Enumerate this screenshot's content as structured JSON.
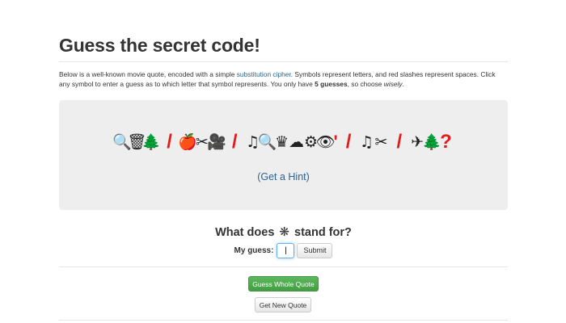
{
  "title": "Guess the secret code!",
  "intro": {
    "part1": "Below is a well-known movie quote, encoded with a simple ",
    "link": "substitution cipher",
    "part2": ". Symbols represent letters, and red slashes represent spaces. Click any symbol to enter a guess as to which letter that symbol represents. You only have ",
    "bold": "5 guesses",
    "part3": ", so choose ",
    "italic": "wisely",
    "part4": "."
  },
  "cipher": {
    "words": [
      {
        "symbols": [
          "🔍",
          "🗑",
          "🌲"
        ],
        "icons": [
          "magnifier-icon",
          "trash-icon",
          "tree-icon"
        ],
        "punct": ""
      },
      {
        "symbols": [
          "🍎",
          "✂",
          "🎥"
        ],
        "icons": [
          "apple-icon",
          "scissors-icon",
          "video-camera-icon"
        ],
        "punct": ""
      },
      {
        "symbols": [
          "♫",
          "🔍",
          "♛",
          "☁",
          "⚙",
          "👁"
        ],
        "icons": [
          "music-note-icon",
          "magnifier-icon",
          "crown-icon",
          "cloud-icon",
          "gear-icon",
          "eye-icon"
        ],
        "punct": "'"
      },
      {
        "symbols": [
          "♫",
          "✂"
        ],
        "icons": [
          "music-note-icon",
          "scissors-icon"
        ],
        "punct": ""
      },
      {
        "symbols": [
          "✈",
          "🌲"
        ],
        "icons": [
          "airplane-icon",
          "tree-icon"
        ],
        "punct": "?"
      }
    ],
    "slash": "/",
    "hint_link": "(Get a Hint)"
  },
  "question": {
    "prefix": "What does",
    "symbol": "❋",
    "suffix": "stand for?"
  },
  "guess": {
    "label": "My guess:",
    "value": "|",
    "submit_label": "Submit"
  },
  "actions": {
    "guess_whole_label": "Guess Whole Quote",
    "new_quote_label": "Get New Quote"
  },
  "colors": {
    "slash": "#e21b1b",
    "link": "#2a6496",
    "success": "#5cb85c",
    "panel": "#eeeeee"
  }
}
